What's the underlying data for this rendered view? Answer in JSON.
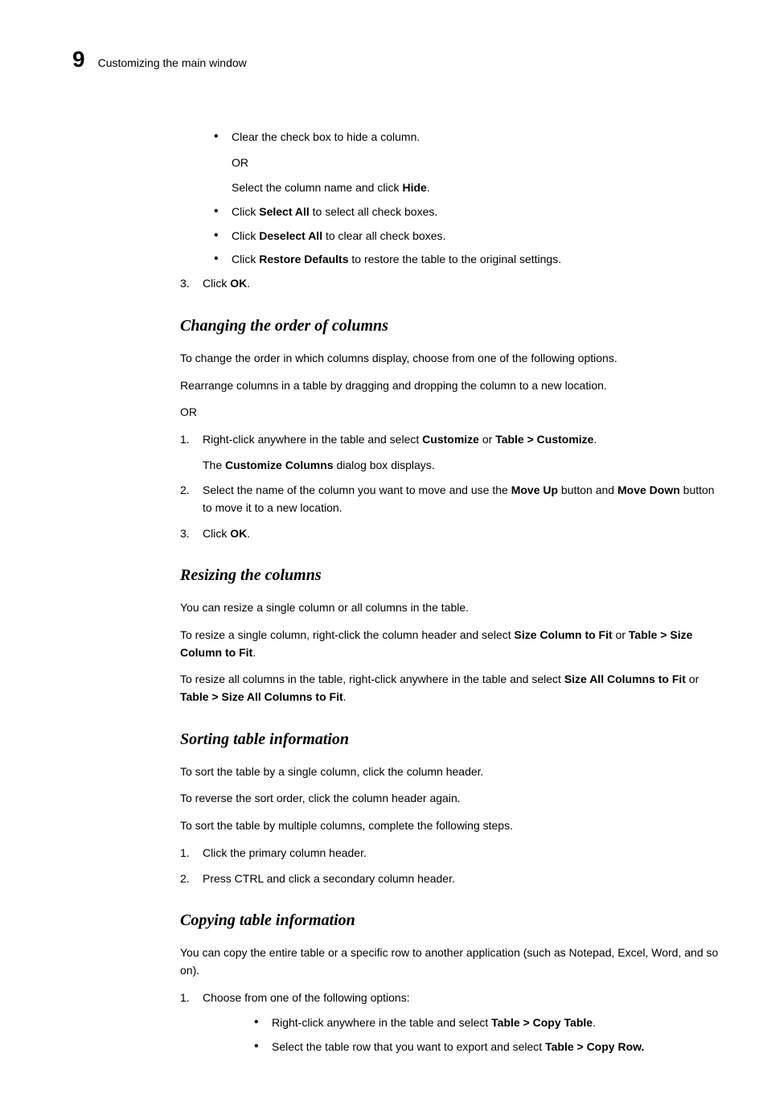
{
  "header": {
    "chapter_number": "9",
    "chapter_title": "Customizing the main window"
  },
  "sections": [
    {
      "type": "bullets",
      "items": [
        {
          "lines": [
            [
              "Clear the check box to hide a column."
            ],
            [
              "OR"
            ],
            [
              "Select the column name and click ",
              {
                "b": "Hide"
              },
              "."
            ]
          ]
        },
        {
          "lines": [
            [
              "Click ",
              {
                "b": "Select All"
              },
              " to select all check boxes."
            ]
          ]
        },
        {
          "lines": [
            [
              "Click ",
              {
                "b": "Deselect All"
              },
              " to clear all check boxes."
            ]
          ]
        },
        {
          "lines": [
            [
              "Click ",
              {
                "b": "Restore Defaults"
              },
              " to restore the table to the original settings."
            ]
          ]
        }
      ]
    },
    {
      "type": "numbered",
      "start": 3,
      "items": [
        {
          "lines": [
            [
              "Click ",
              {
                "b": "OK"
              },
              "."
            ]
          ]
        }
      ]
    },
    {
      "type": "heading",
      "text": "Changing the order of columns"
    },
    {
      "type": "para",
      "runs": [
        "To change the order in which columns display, choose from one of the following options."
      ]
    },
    {
      "type": "para",
      "runs": [
        "Rearrange columns in a table by dragging and dropping the column to a new location."
      ]
    },
    {
      "type": "para",
      "runs": [
        "OR"
      ]
    },
    {
      "type": "numbered",
      "start": 1,
      "items": [
        {
          "lines": [
            [
              "Right-click anywhere in the table and select ",
              {
                "b": "Customize"
              },
              " or ",
              {
                "b": "Table > Customize"
              },
              "."
            ],
            [
              "The ",
              {
                "b": "Customize Columns"
              },
              " dialog box displays."
            ]
          ]
        },
        {
          "lines": [
            [
              "Select the name of the column you want to move and use the ",
              {
                "b": "Move Up"
              },
              " button and ",
              {
                "b": "Move Down"
              },
              " button to move it to a new location."
            ]
          ]
        },
        {
          "lines": [
            [
              "Click ",
              {
                "b": "OK"
              },
              "."
            ]
          ]
        }
      ]
    },
    {
      "type": "heading",
      "text": "Resizing the columns"
    },
    {
      "type": "para",
      "runs": [
        "You can resize a single column or all columns in the table."
      ]
    },
    {
      "type": "para",
      "runs": [
        "To resize a single column, right-click the column header and select ",
        {
          "b": "Size Column to Fit"
        },
        " or ",
        {
          "b": "Table > Size Column to Fit"
        },
        "."
      ]
    },
    {
      "type": "para",
      "runs": [
        "To resize all columns in the table, right-click anywhere in the table and select ",
        {
          "b": "Size All Columns to Fit"
        },
        " or ",
        {
          "b": "Table > Size All Columns to Fit"
        },
        "."
      ]
    },
    {
      "type": "heading",
      "text": "Sorting table information"
    },
    {
      "type": "para",
      "runs": [
        "To sort the table by a single column, click the column header."
      ]
    },
    {
      "type": "para",
      "runs": [
        "To reverse the sort order, click the column header again."
      ]
    },
    {
      "type": "para",
      "runs": [
        "To sort the table by multiple columns, complete the following steps."
      ]
    },
    {
      "type": "numbered",
      "start": 1,
      "items": [
        {
          "lines": [
            [
              "Click the primary column header."
            ]
          ]
        },
        {
          "lines": [
            [
              "Press CTRL and click a secondary column header."
            ]
          ]
        }
      ]
    },
    {
      "type": "heading",
      "text": "Copying table information"
    },
    {
      "type": "para",
      "runs": [
        "You can copy the entire table or a specific row to another application (such as Notepad, Excel, Word, and so on)."
      ]
    },
    {
      "type": "numbered",
      "start": 1,
      "items": [
        {
          "lines": [
            [
              "Choose from one of the following options:"
            ]
          ],
          "sub_bullets": [
            {
              "lines": [
                [
                  "Right-click anywhere in the table and select ",
                  {
                    "b": "Table > Copy Table"
                  },
                  "."
                ]
              ]
            },
            {
              "lines": [
                [
                  "Select the table row that you want to export and select ",
                  {
                    "b": "Table > Copy Row."
                  }
                ]
              ]
            }
          ]
        }
      ]
    }
  ]
}
